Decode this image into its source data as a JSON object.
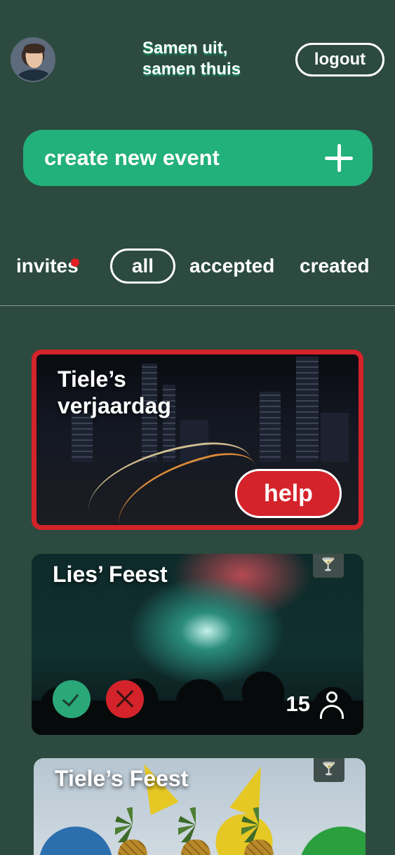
{
  "header": {
    "brand_line1": "Samen uit,",
    "brand_line2": "samen thuis",
    "logout_label": "logout",
    "avatar_icon": "user-avatar"
  },
  "create": {
    "label": "create new event",
    "icon": "plus-icon"
  },
  "tabs": [
    {
      "label": "invites",
      "has_notification": true
    },
    {
      "label": "all",
      "selected": true
    },
    {
      "label": "accepted"
    },
    {
      "label": "created"
    }
  ],
  "events": [
    {
      "title_line1": "Tiele’s",
      "title_line2": "verjaardag",
      "action_label": "help",
      "highlight_color": "#d4232a"
    },
    {
      "title": "Lies’ Feest",
      "attendees": "15",
      "icons": [
        "cocktail-icon",
        "check-icon",
        "close-icon",
        "person-icon"
      ]
    },
    {
      "title": "Tiele’s Feest",
      "icons": [
        "cocktail-icon"
      ]
    }
  ],
  "colors": {
    "background": "#2c4a3f",
    "accent_green": "#22b07b",
    "alert_red": "#d4232a"
  }
}
